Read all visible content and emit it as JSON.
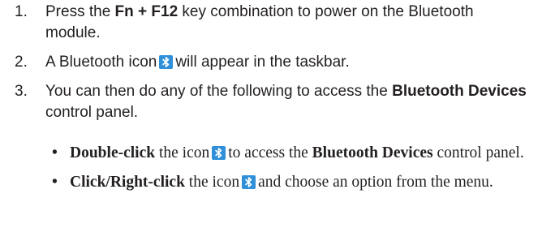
{
  "steps": [
    {
      "num": "1.",
      "pre": "Press the ",
      "key_combo": "Fn + F12",
      "post": " key combination to power on the Bluetooth module."
    },
    {
      "num": "2.",
      "pre": "A Bluetooth icon",
      "icon": "bluetooth-icon",
      "post": "will appear in the taskbar."
    },
    {
      "num": "3.",
      "pre": "You can then do any of the following to access the ",
      "panel_name": "Bluetooth Devices",
      "post": " control panel."
    }
  ],
  "options": [
    {
      "bullet": "•",
      "action": "Double-click",
      "mid": " the icon",
      "icon": "bluetooth-icon",
      "mid2": "to access the ",
      "panel_name": "Bluetooth Devices",
      "post": " control panel."
    },
    {
      "bullet": "•",
      "action": "Click/Right-click",
      "mid": " the icon",
      "icon": "bluetooth-icon",
      "post": "and choose an option from the menu."
    }
  ],
  "colors": {
    "text": "#231f20",
    "icon_bg": "#2f8fd8",
    "icon_fg": "#ffffff"
  }
}
